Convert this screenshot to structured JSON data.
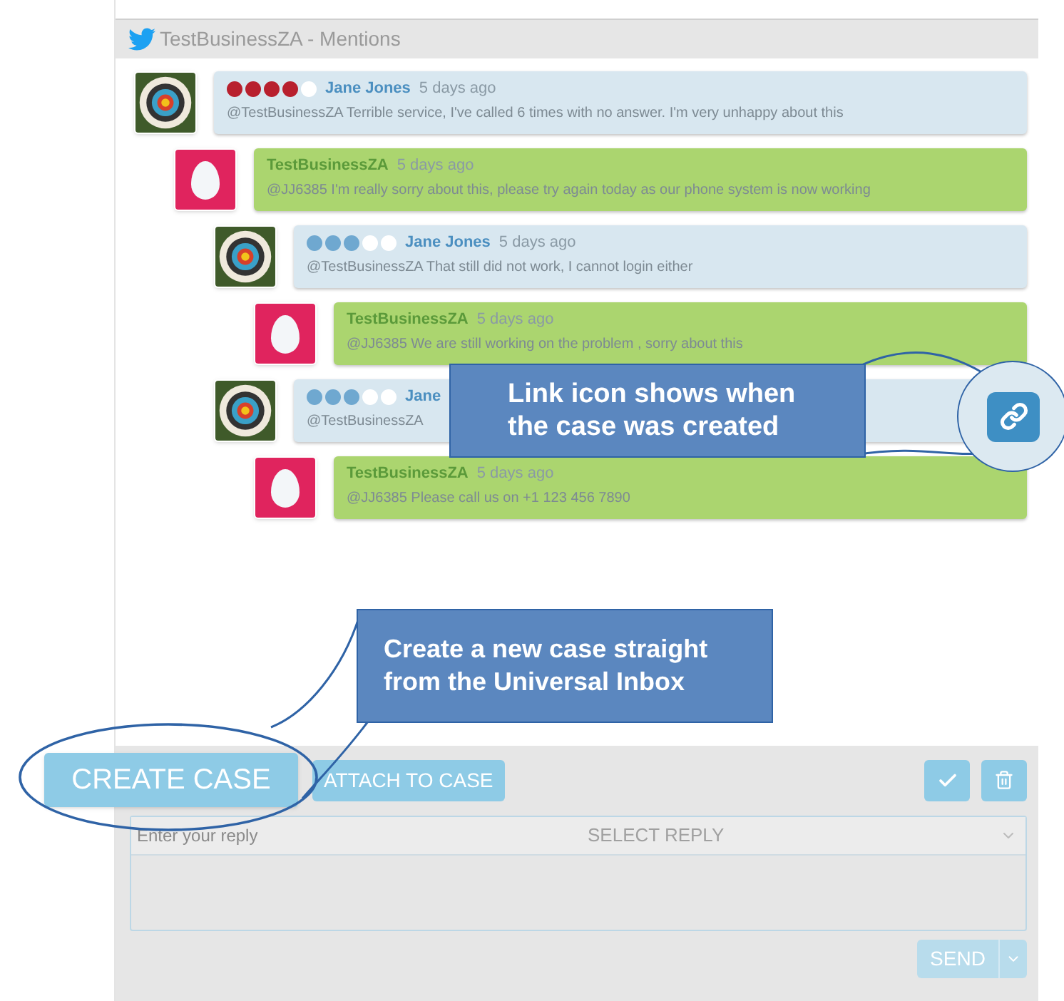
{
  "header": {
    "title": "TestBusinessZA - Mentions"
  },
  "thread": [
    {
      "kind": "customer",
      "stars": 4,
      "color": "#b8202e",
      "name": "Jane Jones",
      "time": "5 days ago",
      "text": "@TestBusinessZA Terrible service, I've called 6 times with no answer. I'm very unhappy about this",
      "children": [
        {
          "kind": "business",
          "name": "TestBusinessZA",
          "time": "5 days ago",
          "text": "@JJ6385 I'm really sorry about this, please try again today as our phone system is now working",
          "children": [
            {
              "kind": "customer",
              "stars": 3,
              "color": "#6fa8d0",
              "name": "Jane Jones",
              "time": "5 days ago",
              "text": "@TestBusinessZA That still did not work, I cannot login either",
              "children": [
                {
                  "kind": "business",
                  "name": "TestBusinessZA",
                  "time": "5 days ago",
                  "text": "@JJ6385 We are still working on the problem , sorry about this"
                }
              ]
            },
            {
              "kind": "customer",
              "stars": 3,
              "color": "#6fa8d0",
              "name": "Jane",
              "text": "@TestBusinessZA",
              "children": [
                {
                  "kind": "business",
                  "name": "TestBusinessZA",
                  "time": "5 days ago",
                  "text": "@JJ6385 Please call us on +1 123 456 7890"
                }
              ]
            }
          ]
        }
      ]
    }
  ],
  "actions": {
    "create_case": "CREATE CASE",
    "attach_to_case": "ATTACH TO CASE"
  },
  "reply": {
    "placeholder": "Enter your reply",
    "select": "SELECT REPLY",
    "send": "SEND"
  },
  "callouts": [
    {
      "text": "Link icon shows when the case was created"
    },
    {
      "text": "Create a new case straight from the Universal Inbox"
    }
  ]
}
